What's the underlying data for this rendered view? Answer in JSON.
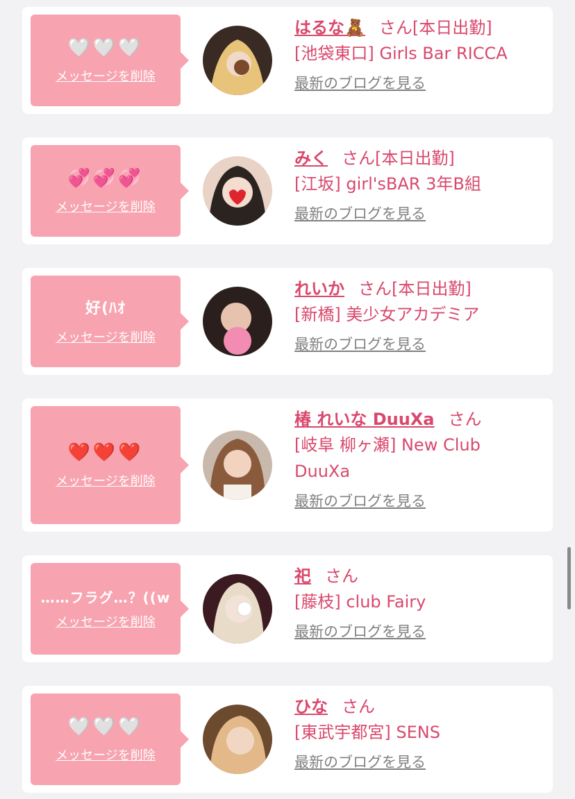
{
  "items": [
    {
      "message": "🤍🤍🤍",
      "delete_label": "メッセージを削除",
      "name": "はるな🧸",
      "honorific": "さん[本日出勤]",
      "shop": "[池袋東口] Girls Bar RICCA",
      "blog_label": "最新のブログを見る",
      "avatar_colors": [
        "#3a2a24",
        "#e8c37a"
      ]
    },
    {
      "message": "💞💞💞",
      "delete_label": "メッセージを削除",
      "name": "みく",
      "honorific": "さん[本日出勤]",
      "shop": "[江坂] girl'sBAR 3年B組",
      "blog_label": "最新のブログを見る",
      "avatar_colors": [
        "#2b2320",
        "#e9d2c6"
      ]
    },
    {
      "message": "好(ﾊｵ",
      "delete_label": "メッセージを削除",
      "name": "れいか",
      "honorific": "さん[本日出勤]",
      "shop": "[新橋] 美少女アカデミア",
      "blog_label": "最新のブログを見る",
      "avatar_colors": [
        "#2a1f1c",
        "#d9a894"
      ]
    },
    {
      "message": "❤️❤️❤️",
      "delete_label": "メッセージを削除",
      "name": "椿 れいな DuuXa",
      "honorific": "さん",
      "shop": "[岐阜 柳ヶ瀬] New Club DuuXa",
      "blog_label": "最新のブログを見る",
      "avatar_colors": [
        "#c9b9ad",
        "#8a5a3c"
      ]
    },
    {
      "message": "……フラグ…？((w",
      "delete_label": "メッセージを削除",
      "name": "祀",
      "honorific": "さん",
      "shop": "[藤枝] club Fairy",
      "blog_label": "最新のブログを見る",
      "avatar_colors": [
        "#3b1a22",
        "#e8dcc8"
      ]
    },
    {
      "message": "🤍🤍🤍",
      "delete_label": "メッセージを削除",
      "name": "ひな",
      "honorific": "さん",
      "shop": "[東武宇都宮] SENS",
      "blog_label": "最新のブログを見る",
      "avatar_colors": [
        "#6b4a2e",
        "#e3b98a"
      ]
    }
  ],
  "colors": {
    "accent": "#d9486c",
    "bubble": "#f7a3b0",
    "link_gray": "#808080",
    "background": "#f2f2f4"
  }
}
